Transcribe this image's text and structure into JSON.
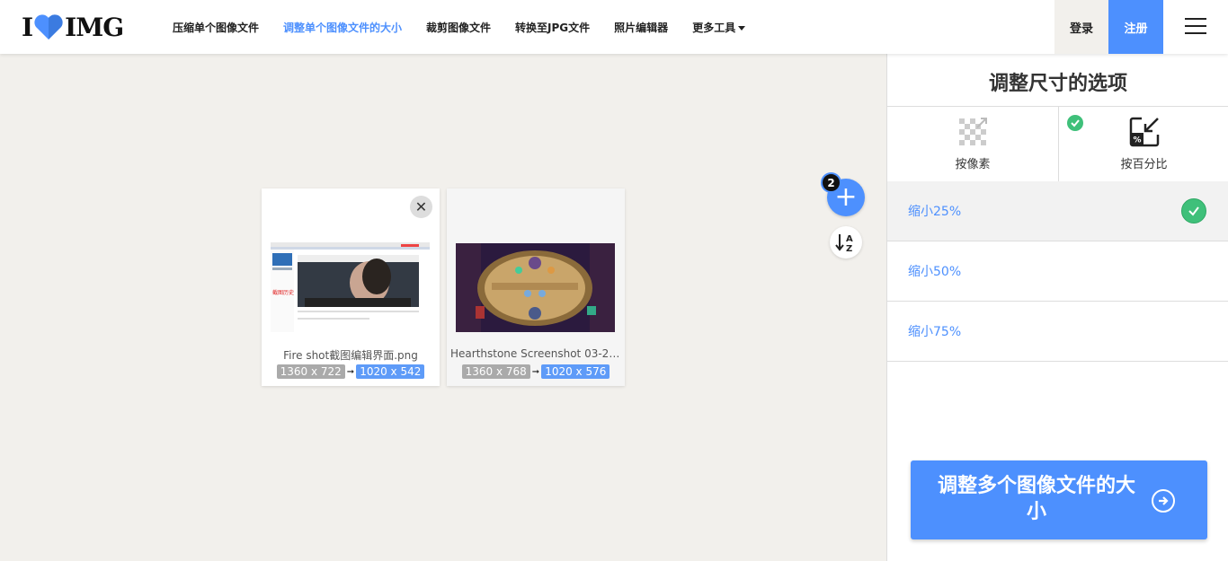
{
  "header": {
    "logo_left": "I",
    "logo_right": "IMG",
    "nav": [
      {
        "label": "压缩单个图像文件",
        "active": false
      },
      {
        "label": "调整单个图像文件的大小",
        "active": true
      },
      {
        "label": "裁剪图像文件",
        "active": false
      },
      {
        "label": "转换至JPG文件",
        "active": false
      },
      {
        "label": "照片编辑器",
        "active": false
      },
      {
        "label": "更多工具",
        "active": false
      }
    ],
    "login": "登录",
    "register": "注册"
  },
  "workspace": {
    "file_count": "2",
    "files": [
      {
        "name": "Fire shot截图编辑界面.png",
        "original_size": "1360 x 722",
        "new_size": "1020 x 542",
        "thumb_text": "截图历史"
      },
      {
        "name": "Hearthstone Screenshot 03-21-...",
        "original_size": "1360 x 768",
        "new_size": "1020 x 576"
      }
    ]
  },
  "sidebar": {
    "title": "调整尺寸的选项",
    "tabs": [
      {
        "label": "按像素",
        "selected": false
      },
      {
        "label": "按百分比",
        "selected": true
      }
    ],
    "options": [
      {
        "label": "缩小25%",
        "selected": true
      },
      {
        "label": "缩小50%",
        "selected": false
      },
      {
        "label": "缩小75%",
        "selected": false
      }
    ],
    "submit": "调整多个图像文件的大小"
  },
  "colors": {
    "accent": "#4d90fe",
    "check": "#3fc07a",
    "background": "#f2f0ec"
  }
}
